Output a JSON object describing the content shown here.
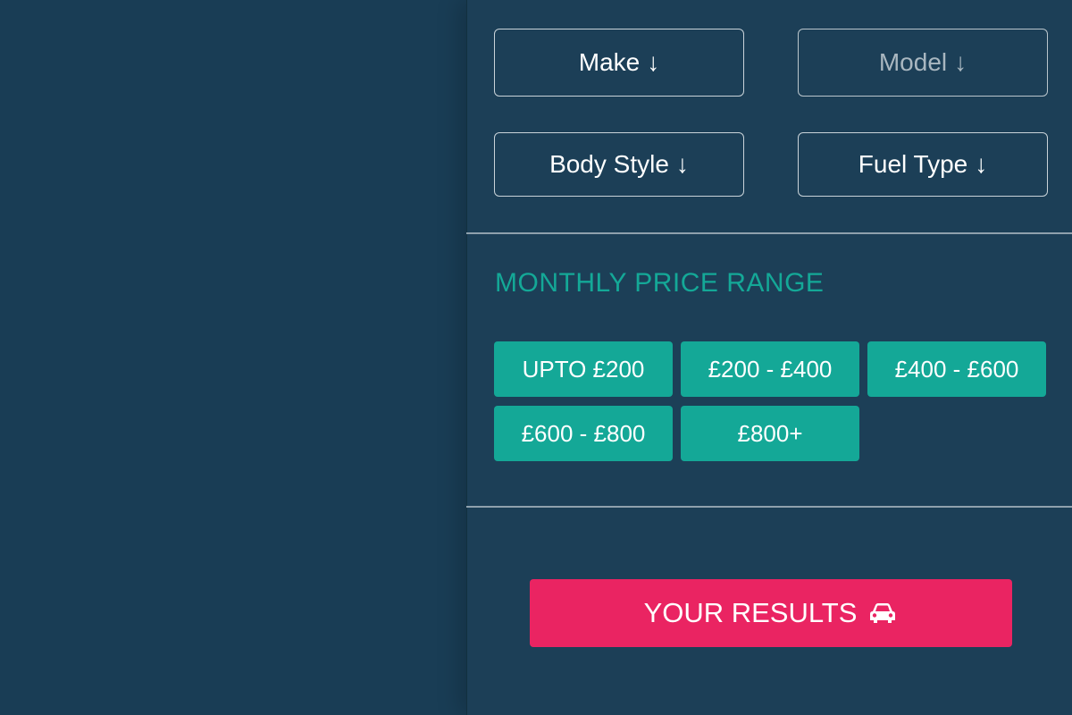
{
  "filters": {
    "make": {
      "label": "Make",
      "arrow": "↓"
    },
    "model": {
      "label": "Model",
      "arrow": "↓"
    },
    "body_style": {
      "label": "Body Style",
      "arrow": "↓"
    },
    "fuel_type": {
      "label": "Fuel Type",
      "arrow": "↓"
    }
  },
  "price_range": {
    "title": "MONTHLY PRICE RANGE",
    "options": [
      "UPTO £200",
      "£200 - £400",
      "£400 - £600",
      "£600 - £800",
      "£800+"
    ]
  },
  "results": {
    "label": "YOUR RESULTS",
    "icon": "car-icon"
  },
  "colors": {
    "background": "#193d55",
    "accent_teal": "#14a897",
    "accent_pink": "#ea2462"
  }
}
